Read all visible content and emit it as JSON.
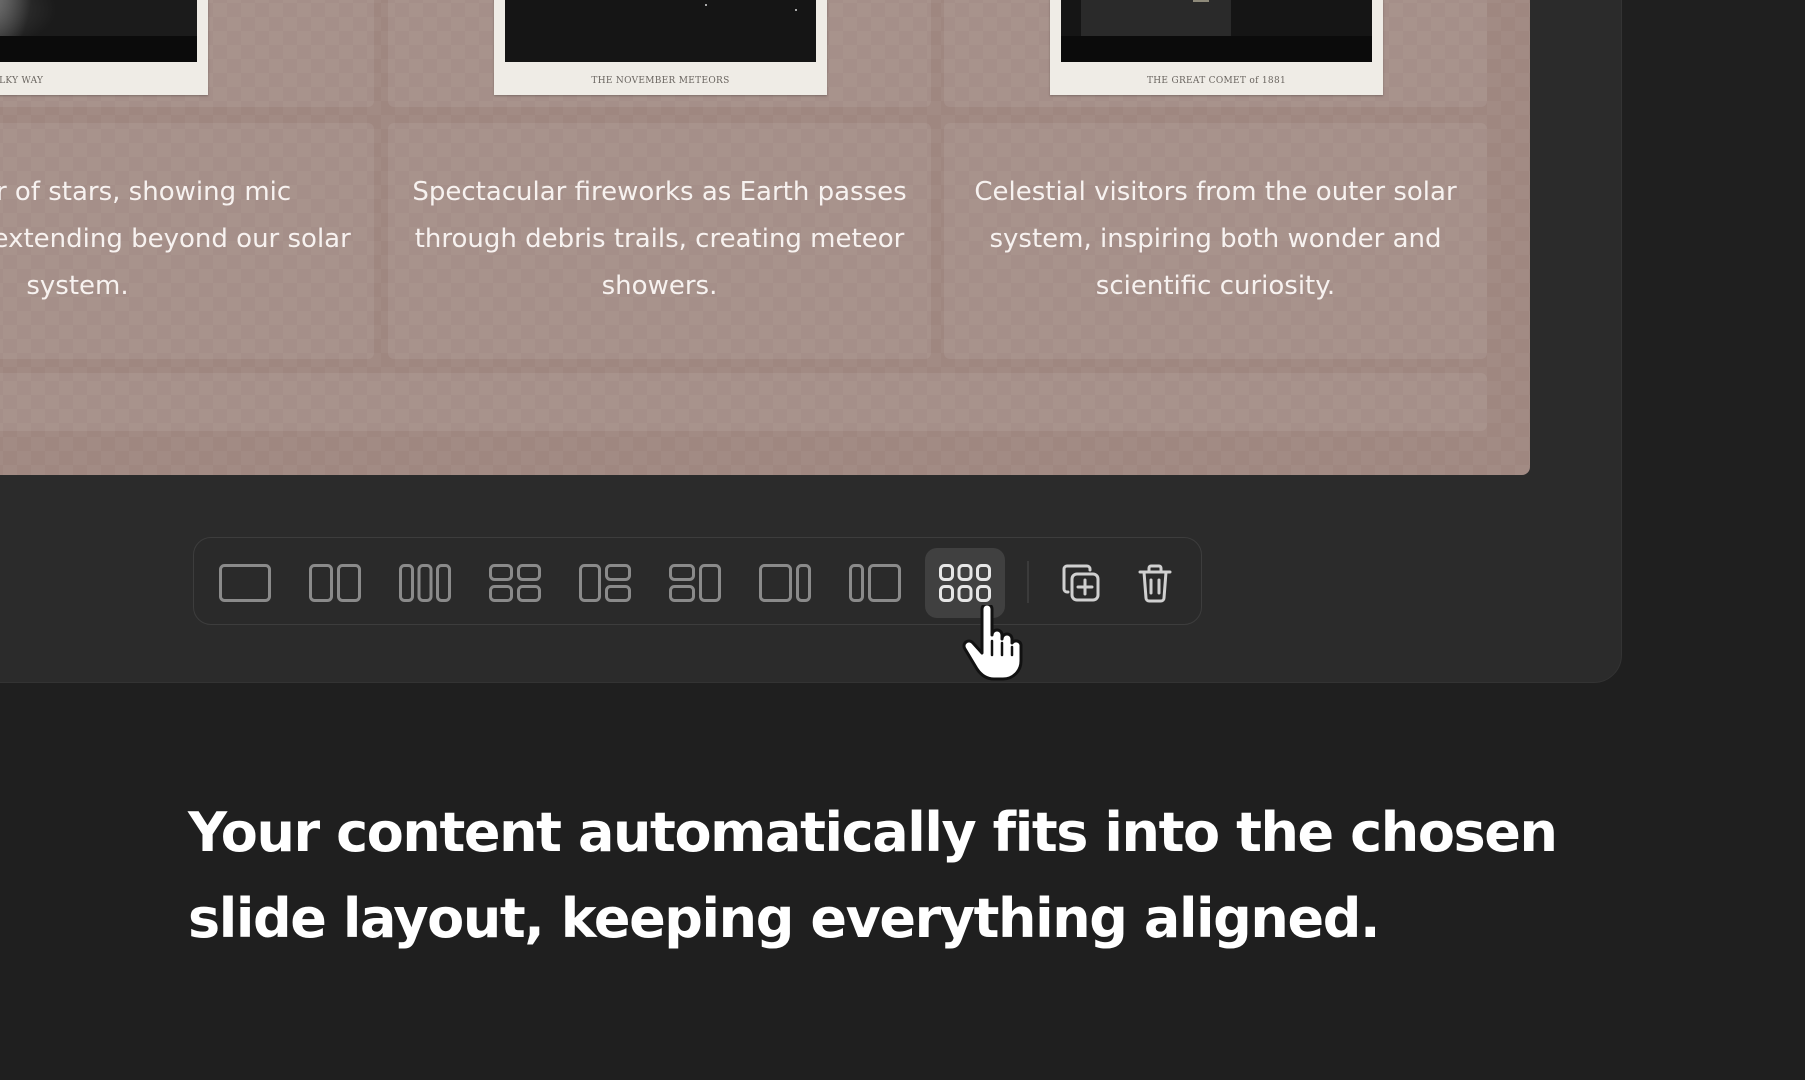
{
  "slide": {
    "images": [
      {
        "caption": "PART of the MILKY WAY"
      },
      {
        "caption": "THE NOVEMBER METEORS"
      },
      {
        "caption": "THE GREAT COMET of 1881"
      }
    ],
    "descriptions": [
      "laxy's river of stars, showing mic neighborhood extending beyond our solar system.",
      "Spectacular fireworks as Earth passes through debris trails, creating meteor showers.",
      "Celestial visitors from the outer solar system, inspiring both wonder and scientific curiosity."
    ],
    "background_color": "#9f8780"
  },
  "toolbar": {
    "layout_options": [
      {
        "icon": "layout-single-icon",
        "selected": false
      },
      {
        "icon": "layout-two-columns-icon",
        "selected": false
      },
      {
        "icon": "layout-three-columns-icon",
        "selected": false
      },
      {
        "icon": "layout-grid-2x2-icon",
        "selected": false
      },
      {
        "icon": "layout-column-left-rows-right-icon",
        "selected": false
      },
      {
        "icon": "layout-rows-left-column-right-icon",
        "selected": false
      },
      {
        "icon": "layout-wide-left-narrow-right-icon",
        "selected": false
      },
      {
        "icon": "layout-narrow-left-wide-right-icon",
        "selected": false
      },
      {
        "icon": "layout-grid-3x2-icon",
        "selected": true
      }
    ],
    "actions": [
      {
        "icon": "duplicate-icon"
      },
      {
        "icon": "trash-icon"
      }
    ],
    "active_color": "#404040"
  },
  "headline": {
    "line1": "Your content automatically fits into the chosen",
    "line2": "slide layout, keeping everything aligned."
  }
}
